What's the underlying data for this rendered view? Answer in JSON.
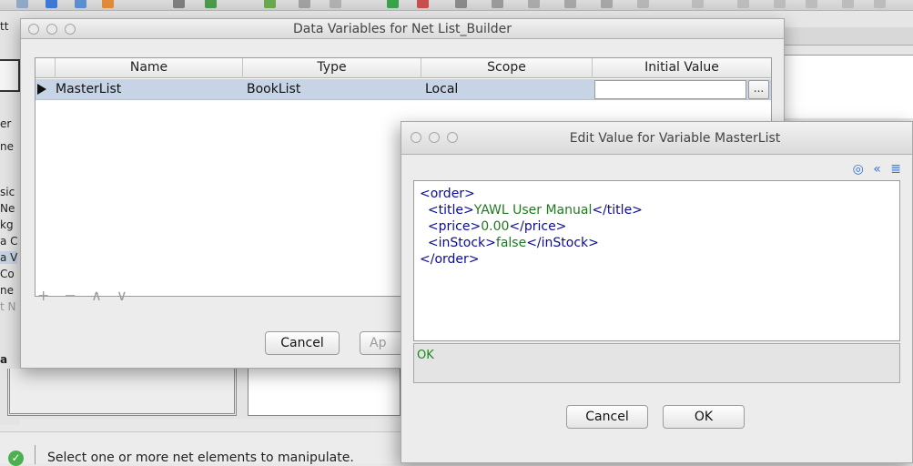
{
  "data_variables_dialog": {
    "title": "Data Variables for Net List_Builder",
    "columns": [
      "Name",
      "Type",
      "Scope",
      "Initial Value"
    ],
    "rows": [
      {
        "name": "MasterList",
        "type": "BookList",
        "scope": "Local",
        "initial_value": ""
      }
    ],
    "ellipsis_label": "...",
    "table_controls": [
      "+",
      "−",
      "∧",
      "∨"
    ],
    "cancel_label": "Cancel",
    "apply_label_partial": "Ap"
  },
  "edit_value_dialog": {
    "title": "Edit Value for Variable MasterList",
    "toolbar_icons": [
      "target-icon",
      "collapse-left-icon",
      "align-icon"
    ],
    "xml_lines": [
      {
        "indent": "",
        "open": "<order>",
        "text": "",
        "close": ""
      },
      {
        "indent": "  ",
        "open": "<title>",
        "text": "YAWL User Manual",
        "close": "</title>"
      },
      {
        "indent": "  ",
        "open": "<price>",
        "text": "0.00",
        "close": "</price>"
      },
      {
        "indent": "  ",
        "open": "<inStock>",
        "text": "false",
        "close": "</inStock>"
      },
      {
        "indent": "",
        "open": "</order>",
        "text": "",
        "close": ""
      }
    ],
    "validation_status": "OK",
    "cancel_label": "Cancel",
    "ok_label": "OK"
  },
  "background_app": {
    "status_text": "Select one or more net elements to manipulate.",
    "left_strip_fragments": [
      "tt",
      "er",
      "ne",
      "sic",
      "Ne",
      "kg",
      "a C",
      "a V",
      "Co",
      "ne",
      "t N",
      "a"
    ]
  },
  "colors": {
    "selected_row": "#c6d4e6",
    "xml_tag": "#0a0a9c",
    "xml_text": "#1f7a1f",
    "status_ok": "#1a8a1a"
  }
}
